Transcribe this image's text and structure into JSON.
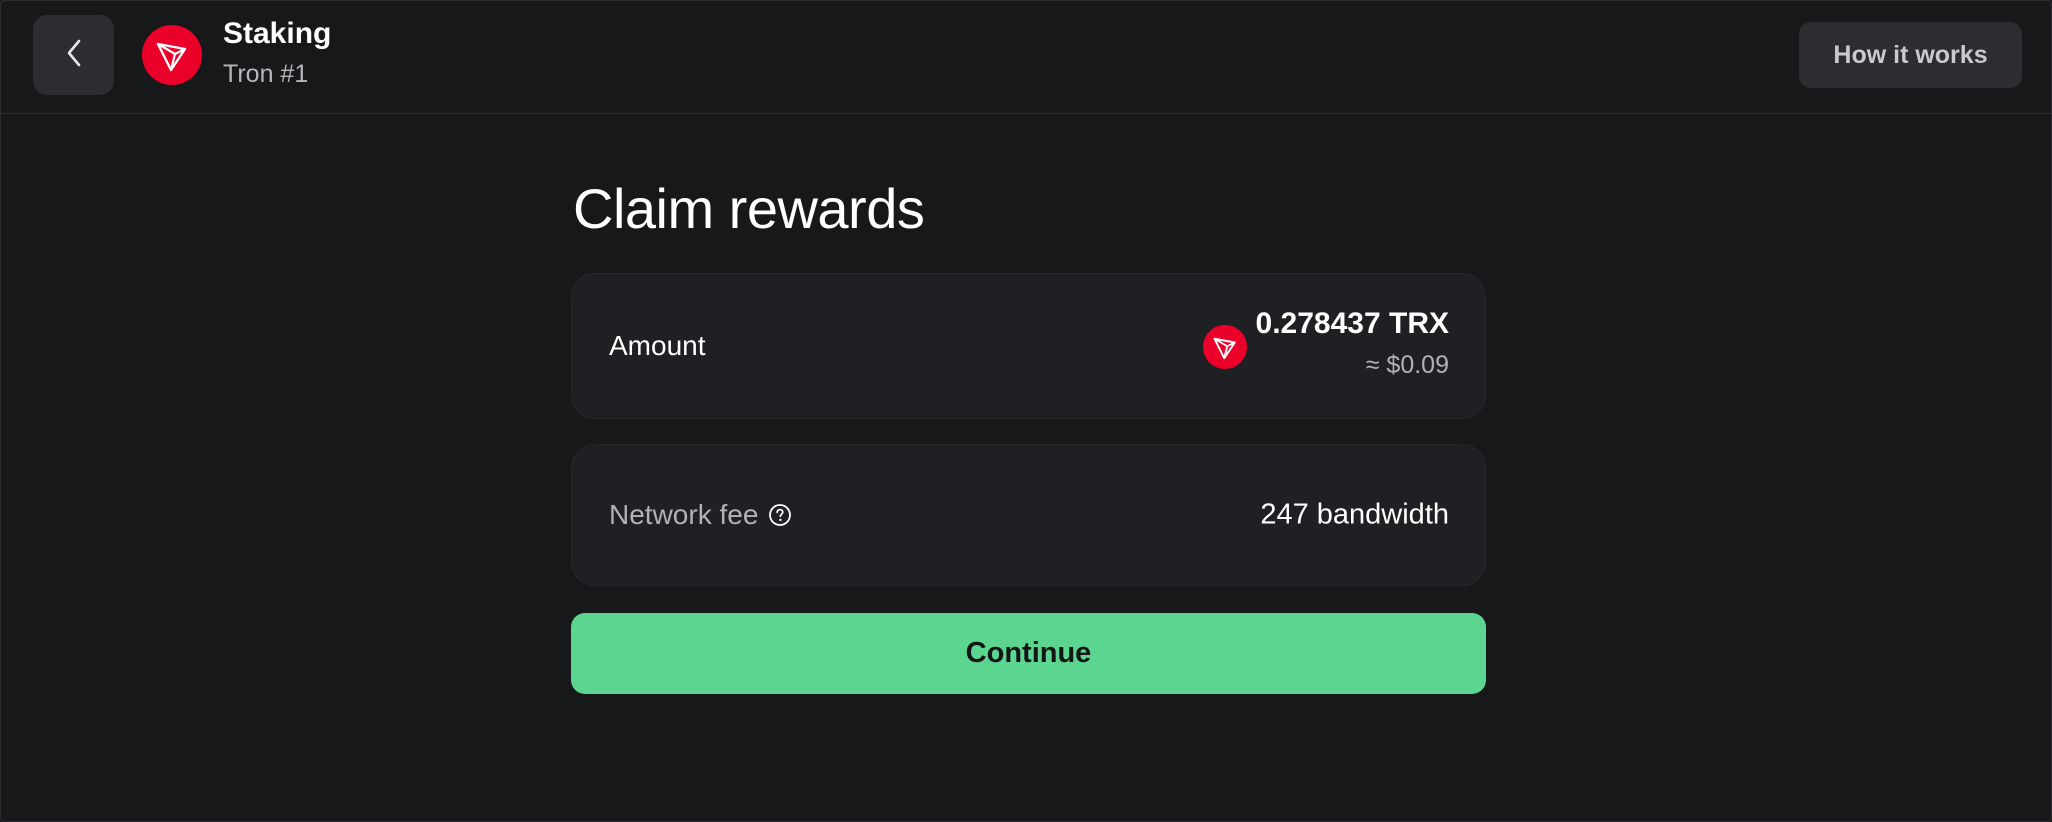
{
  "colors": {
    "background": "#17181a",
    "card": "#1f2023",
    "button_secondary": "#2b2d30",
    "accent_green": "#5bd58f",
    "tron_red": "#eb0029"
  },
  "header": {
    "back_icon": "chevron-left-icon",
    "avatar_icon": "tron-logo-icon",
    "title": "Staking",
    "subtitle": "Tron #1",
    "how_it_works_label": "How it works"
  },
  "main": {
    "title": "Claim rewards",
    "amount": {
      "label": "Amount",
      "token_icon": "tron-logo-icon",
      "value": "0.278437 TRX",
      "fiat": "≈ $0.09"
    },
    "network_fee": {
      "label": "Network fee",
      "help_icon": "question-circle-icon",
      "value": "247 bandwidth"
    },
    "continue_label": "Continue"
  }
}
